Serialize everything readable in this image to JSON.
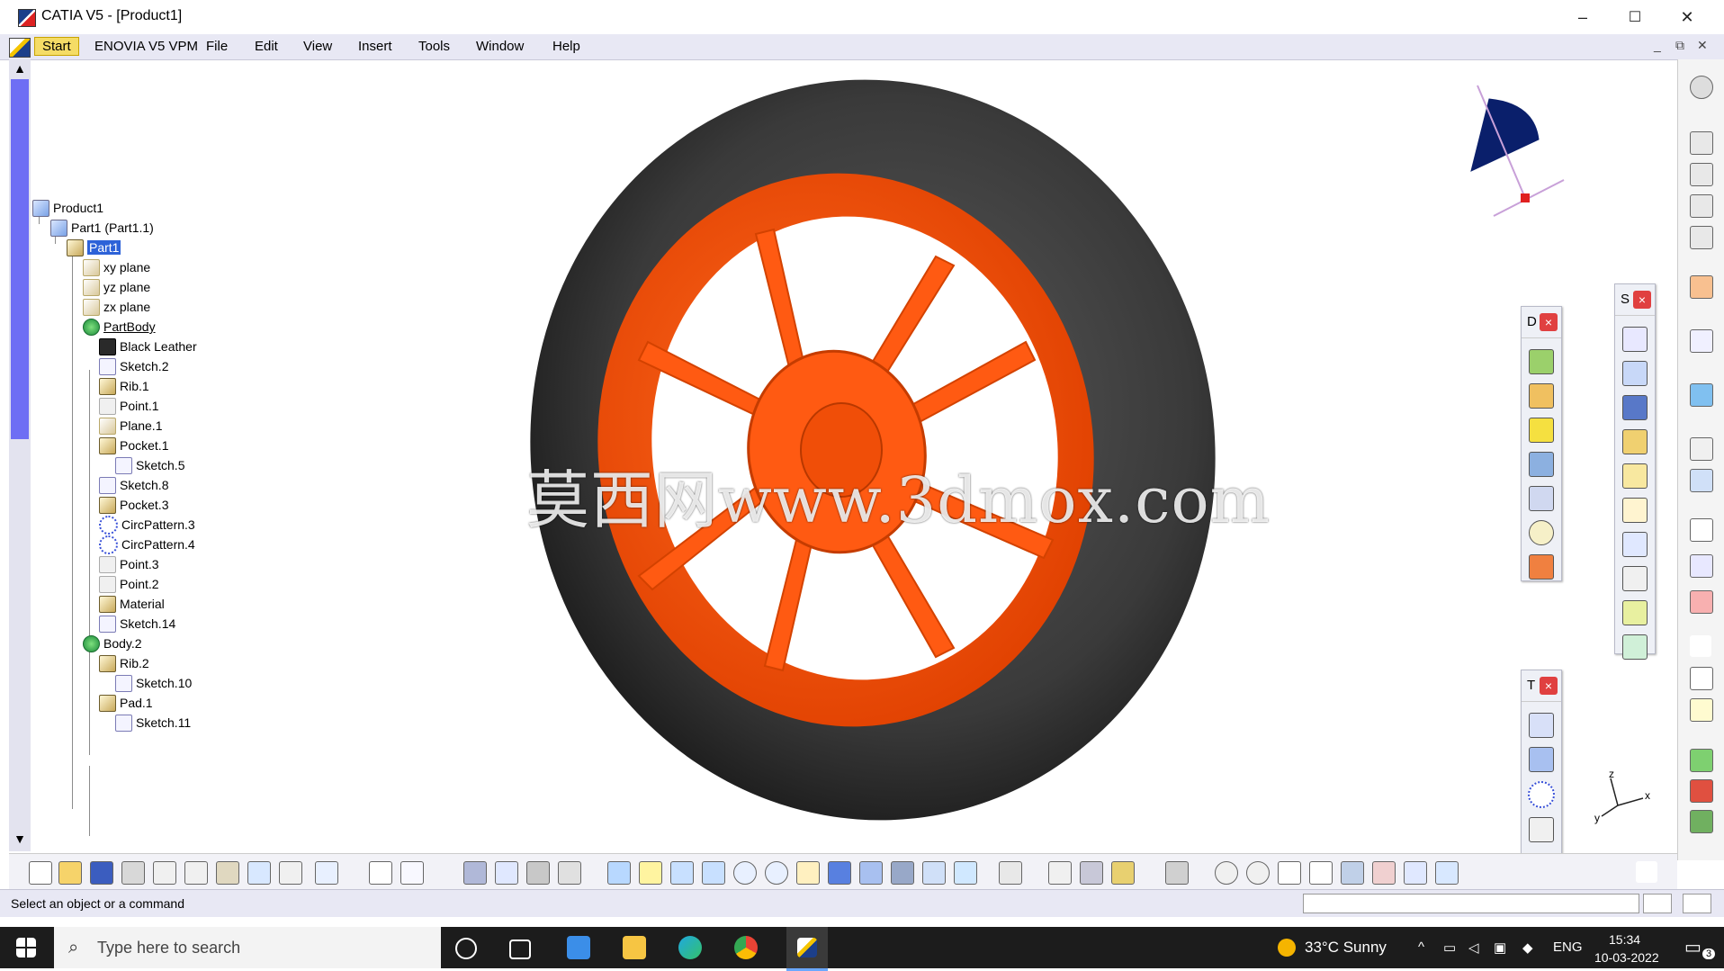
{
  "window": {
    "title": "CATIA V5 - [Product1]",
    "controls": [
      "–",
      "☐",
      "✕"
    ]
  },
  "menubar": {
    "items": [
      "Start",
      "ENOVIA V5 VPM",
      "File",
      "Edit",
      "View",
      "Insert",
      "Tools",
      "Window",
      "Help"
    ],
    "mdi_controls": [
      "_",
      "⧉",
      "✕"
    ]
  },
  "tree": [
    {
      "label": "Product1"
    },
    {
      "label": "Part1 (Part1.1)"
    },
    {
      "label": "Part1"
    },
    {
      "label": "xy plane"
    },
    {
      "label": "yz plane"
    },
    {
      "label": "zx plane"
    },
    {
      "label": "PartBody"
    },
    {
      "label": "Black Leather"
    },
    {
      "label": "Sketch.2"
    },
    {
      "label": "Rib.1"
    },
    {
      "label": "Point.1"
    },
    {
      "label": "Plane.1"
    },
    {
      "label": "Pocket.1"
    },
    {
      "label": "Sketch.5"
    },
    {
      "label": "Sketch.8"
    },
    {
      "label": "Pocket.3"
    },
    {
      "label": "CircPattern.3"
    },
    {
      "label": "CircPattern.4"
    },
    {
      "label": "Point.3"
    },
    {
      "label": "Point.2"
    },
    {
      "label": "Material"
    },
    {
      "label": "Sketch.14"
    },
    {
      "label": "Body.2"
    },
    {
      "label": "Rib.2"
    },
    {
      "label": "Sketch.10"
    },
    {
      "label": "Pad.1"
    },
    {
      "label": "Sketch.11"
    }
  ],
  "viewport": {
    "watermark": "莫西网www.3dmox.com",
    "tire_color": "#3a3a3a",
    "rim_color": "#ff4e0a",
    "axis_labels": {
      "z": "z",
      "x": "x",
      "y": "y"
    }
  },
  "floating_toolbars": {
    "d_title": "D",
    "s_title": "S",
    "t_title": "T",
    "close_glyph": "×"
  },
  "status": {
    "message": "Select an object or a command"
  },
  "taskbar": {
    "search_placeholder": "Type here to search",
    "weather": "33°C  Sunny",
    "language": "ENG",
    "time": "15:34",
    "date": "10-03-2022",
    "notification_count": "3"
  },
  "colors": {
    "accent_selected": "#2d62d8",
    "menubar_bg": "#e8e8f4",
    "scroll_thumb": "#6e6ef4"
  }
}
